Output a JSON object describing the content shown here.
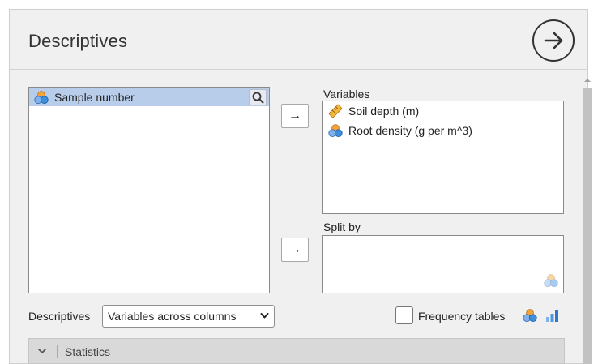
{
  "header": {
    "title": "Descriptives"
  },
  "source_list": {
    "items": [
      {
        "label": "Sample number",
        "icon": "nominal-variable-icon",
        "selected": true
      }
    ]
  },
  "variables": {
    "label": "Variables",
    "items": [
      {
        "label": "Soil depth (m)",
        "icon": "ruler-scale-icon"
      },
      {
        "label": "Root density (g per m^3)",
        "icon": "nominal-variable-icon"
      }
    ]
  },
  "split_by": {
    "label": "Split by"
  },
  "controls": {
    "arrow_glyph": "→",
    "descriptives_label": "Descriptives",
    "layout_select_value": "Variables across columns",
    "frequency_tables_label": "Frequency tables",
    "frequency_tables_checked": false
  },
  "sections": [
    {
      "title": "Statistics",
      "expanded": false
    }
  ],
  "colors": {
    "selection": "#b8cde9",
    "panel": "#f0f0f0",
    "accent_blue": "#3e8ede",
    "accent_orange": "#f2a33a"
  }
}
